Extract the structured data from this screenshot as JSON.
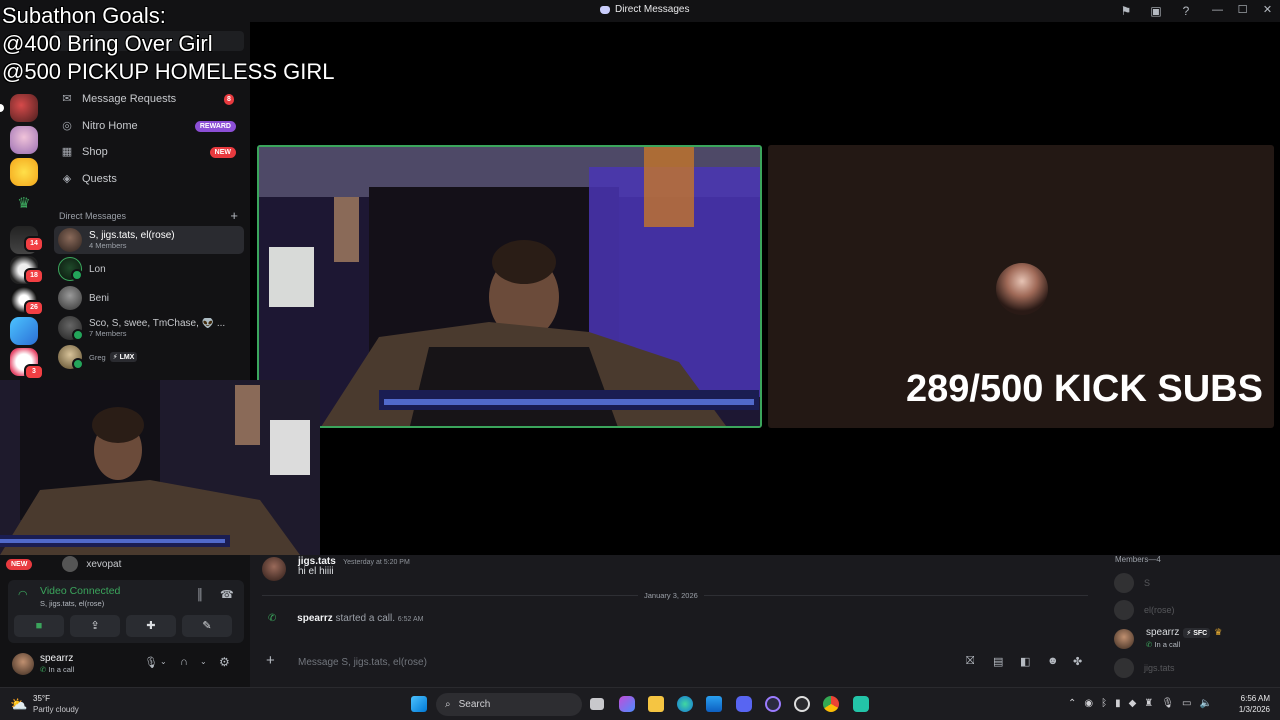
{
  "window": {
    "title": "Direct Messages"
  },
  "overlay": {
    "goals_title": "Subathon Goals:",
    "goal_1": "@400 Bring Over Girl",
    "goal_2": "@500 PICKUP HOMELESS GIRL",
    "subs_counter": "289/500 KICK SUBS"
  },
  "rail": {
    "badges": [
      "14",
      "18",
      "26",
      "3"
    ]
  },
  "sidebar": {
    "nav": [
      {
        "label": "Message Requests",
        "badge": "8",
        "icon": "envelope-icon"
      },
      {
        "label": "Nitro Home",
        "badge": "REWARD",
        "icon": "nitro-icon"
      },
      {
        "label": "Shop",
        "badge": "NEW",
        "icon": "shop-icon"
      },
      {
        "label": "Quests",
        "badge": "",
        "icon": "quests-icon"
      }
    ],
    "dm_header": "Direct Messages",
    "dms": [
      {
        "name": "S, jigs.tats, el(rose)",
        "sub": "4 Members"
      },
      {
        "name": "Lon",
        "sub": ""
      },
      {
        "name": "Beni",
        "sub": ""
      },
      {
        "name": "Sco, S, swee, TmChase, 👽 ...",
        "sub": "7 Members"
      },
      {
        "name": "Greg",
        "sub": "LMX"
      }
    ],
    "hidden_dm": {
      "name": "xevopat",
      "badge": "NEW"
    }
  },
  "voice": {
    "status": "Video Connected",
    "channel": "S, jigs.tats, el(rose)"
  },
  "user": {
    "name": "spearrz",
    "status": "In a call"
  },
  "chat": {
    "messages": [
      {
        "author": "jigs.tats",
        "time": "Yesterday at 5:20 PM",
        "text": "hi el hiiii"
      }
    ],
    "date_divider": "January 3, 2026",
    "call_author": "spearrz",
    "call_text": "started a call.",
    "call_time": "6:52 AM",
    "composer_placeholder": "Message S, jigs.tats, el(rose)"
  },
  "members": {
    "header": "Members—4",
    "list": [
      {
        "name": "S",
        "status": ""
      },
      {
        "name": "el(rose)",
        "status": ""
      },
      {
        "name": "spearrz",
        "tag": "SFC",
        "status": "In a call"
      },
      {
        "name": "jigs.tats",
        "status": ""
      }
    ]
  },
  "taskbar": {
    "weather_temp": "35°F",
    "weather_desc": "Partly cloudy",
    "search": "Search",
    "time": "6:56 AM",
    "date": "1/3/2026"
  },
  "colors": {
    "accent_green": "#3ba55c",
    "badge_red": "#e83a3f",
    "nitro_purple": "#8c4fd6"
  }
}
